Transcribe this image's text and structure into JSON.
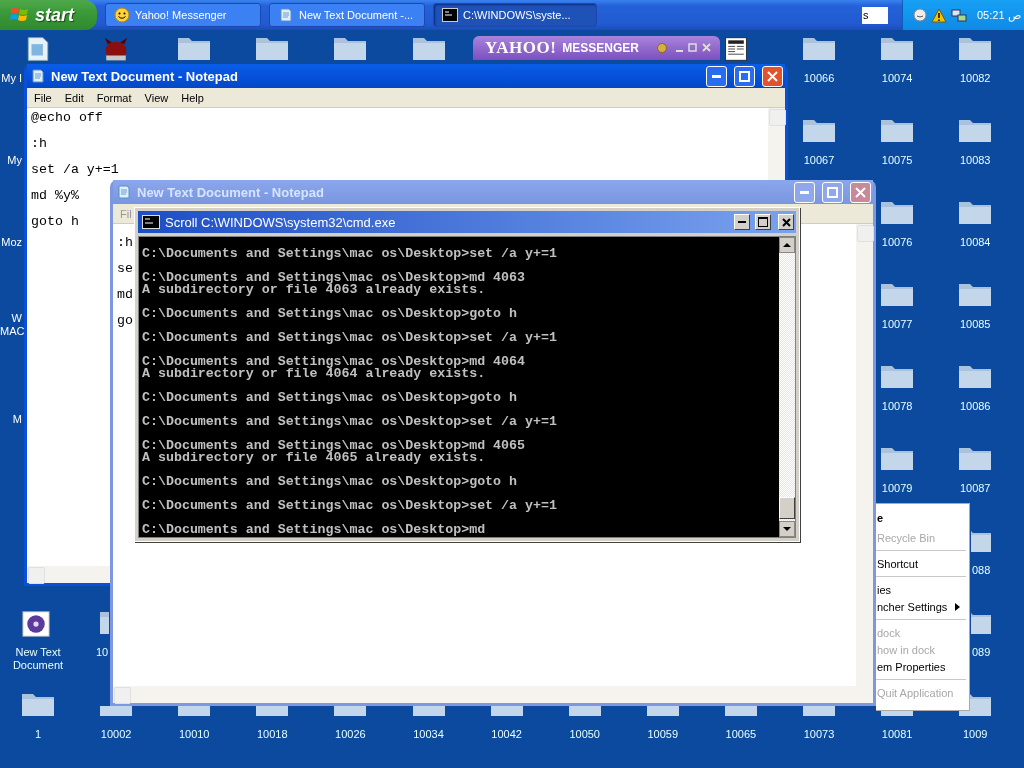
{
  "taskbar": {
    "start": "start",
    "buttons": [
      {
        "label": "Yahoo! Messenger",
        "kind": "messenger",
        "selected": false
      },
      {
        "label": "New Text Document -...",
        "kind": "notepad",
        "selected": false
      },
      {
        "label": "C:\\WINDOWS\\syste...",
        "kind": "console",
        "selected": true
      }
    ],
    "input_value": "s",
    "clock": "05:21 ص"
  },
  "desktop": {
    "edge_labels": [
      "My I",
      "My",
      "Moz",
      "W\nMAC",
      "M"
    ],
    "icons": [
      {
        "kind": "document"
      },
      {
        "kind": "creature"
      },
      {
        "kind": "folder"
      },
      {
        "kind": "folder"
      },
      {
        "kind": "folder"
      },
      {
        "kind": "folder"
      },
      {
        "kind": "newspaper"
      },
      {
        "kind": "folder",
        "label": "10066"
      },
      {
        "kind": "folder",
        "label": "10074"
      },
      {
        "kind": "folder",
        "label": "10082"
      },
      {
        "kind": "folder",
        "label": "10067"
      },
      {
        "kind": "folder",
        "label": "10075"
      },
      {
        "kind": "folder",
        "label": "10083"
      },
      {
        "kind": "folder",
        "label": "10076"
      },
      {
        "kind": "folder",
        "label": "10084"
      },
      {
        "kind": "folder",
        "label": "10077"
      },
      {
        "kind": "folder",
        "label": "10085"
      },
      {
        "kind": "folder",
        "label": "10078"
      },
      {
        "kind": "folder",
        "label": "10086"
      },
      {
        "kind": "folder",
        "label": "10079"
      },
      {
        "kind": "folder",
        "label": "10087"
      },
      {
        "kind": "folder",
        "label": "088"
      },
      {
        "kind": "media",
        "label": "New Text Document"
      },
      {
        "kind": "folder",
        "label": "10"
      },
      {
        "kind": "folder",
        "label": "089"
      },
      {
        "kind": "folder",
        "label": "1"
      },
      {
        "kind": "folder",
        "label": "10002"
      },
      {
        "kind": "folder",
        "label": "10010"
      },
      {
        "kind": "folder",
        "label": "10018"
      },
      {
        "kind": "folder",
        "label": "10026"
      },
      {
        "kind": "folder",
        "label": "10034"
      },
      {
        "kind": "folder",
        "label": "10042"
      },
      {
        "kind": "folder",
        "label": "10050"
      },
      {
        "kind": "folder",
        "label": "10059"
      },
      {
        "kind": "folder",
        "label": "10065"
      },
      {
        "kind": "folder",
        "label": "10073"
      },
      {
        "kind": "folder",
        "label": "10081"
      },
      {
        "kind": "folder",
        "label": "1009"
      }
    ]
  },
  "messenger_bar": {
    "logo": "YAHOO!",
    "name": "MESSENGER"
  },
  "notepad_back": {
    "title": "New Text Document - Notepad",
    "active": true,
    "menu": [
      "File",
      "Edit",
      "Format",
      "View",
      "Help"
    ],
    "lines": [
      "@echo off",
      ":h",
      "set /a y+=1",
      "md %y%",
      "goto h"
    ]
  },
  "notepad_front": {
    "title": "New Text Document - Notepad",
    "active": false,
    "menu": [
      "Fil"
    ],
    "lines": [
      ":h",
      "se",
      "md",
      "go"
    ]
  },
  "console": {
    "title": "Scroll C:\\WINDOWS\\system32\\cmd.exe",
    "blocks": [
      [
        "C:\\Documents and Settings\\mac os\\Desktop>set /a y+=1"
      ],
      [
        "C:\\Documents and Settings\\mac os\\Desktop>md 4063",
        "A subdirectory or file 4063 already exists."
      ],
      [
        "C:\\Documents and Settings\\mac os\\Desktop>goto h"
      ],
      [
        "C:\\Documents and Settings\\mac os\\Desktop>set /a y+=1"
      ],
      [
        "C:\\Documents and Settings\\mac os\\Desktop>md 4064",
        "A subdirectory or file 4064 already exists."
      ],
      [
        "C:\\Documents and Settings\\mac os\\Desktop>goto h"
      ],
      [
        "C:\\Documents and Settings\\mac os\\Desktop>set /a y+=1"
      ],
      [
        "C:\\Documents and Settings\\mac os\\Desktop>md 4065",
        "A subdirectory or file 4065 already exists."
      ],
      [
        "C:\\Documents and Settings\\mac os\\Desktop>goto h"
      ],
      [
        "C:\\Documents and Settings\\mac os\\Desktop>set /a y+=1"
      ],
      [
        "C:\\Documents and Settings\\mac os\\Desktop>md"
      ]
    ]
  },
  "context_menu": [
    {
      "kind": "item",
      "label": "e",
      "default": true,
      "disabled": false,
      "submenu": false
    },
    {
      "kind": "item",
      "label": "Recycle Bin",
      "default": false,
      "disabled": true,
      "submenu": false
    },
    {
      "kind": "separator"
    },
    {
      "kind": "item",
      "label": "Shortcut",
      "default": false,
      "disabled": false,
      "submenu": false
    },
    {
      "kind": "separator"
    },
    {
      "kind": "item",
      "label": "ies",
      "default": false,
      "disabled": false,
      "submenu": false
    },
    {
      "kind": "item",
      "label": "ncher Settings",
      "default": false,
      "disabled": false,
      "submenu": true
    },
    {
      "kind": "separator"
    },
    {
      "kind": "item",
      "label": "dock",
      "default": false,
      "disabled": true,
      "submenu": false
    },
    {
      "kind": "item",
      "label": "how in dock",
      "default": false,
      "disabled": true,
      "submenu": false
    },
    {
      "kind": "item",
      "label": "em Properties",
      "default": false,
      "disabled": false,
      "submenu": false
    },
    {
      "kind": "separator"
    },
    {
      "kind": "item",
      "label": "Quit Application",
      "default": false,
      "disabled": true,
      "submenu": false
    }
  ]
}
